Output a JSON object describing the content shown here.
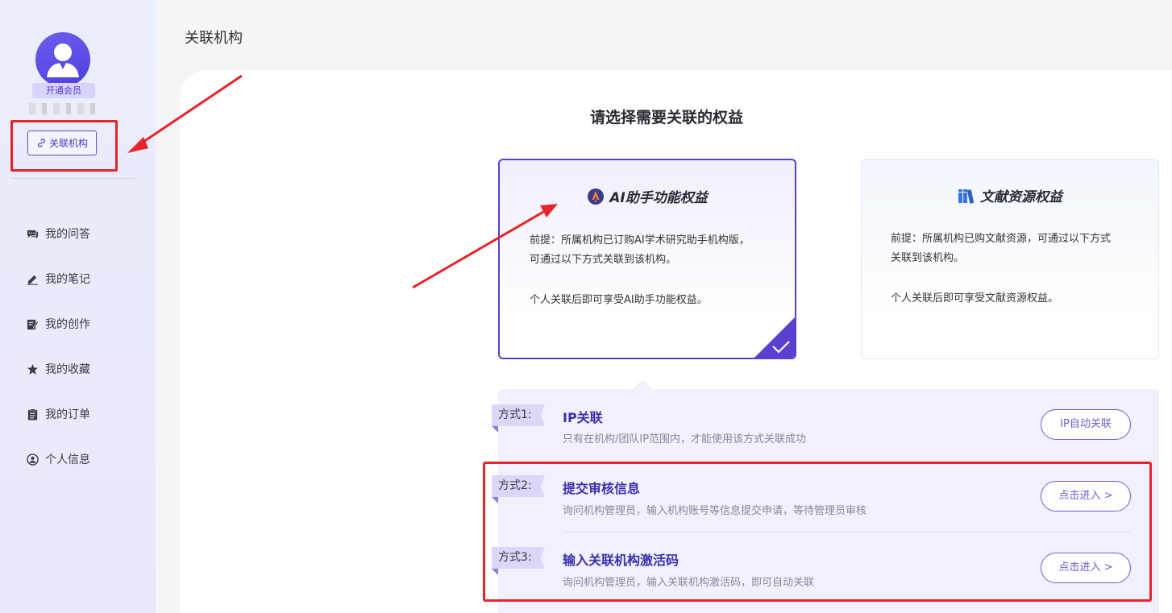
{
  "sidebar": {
    "vip_label": "开通会员",
    "link_org_label": "关联机构",
    "items": [
      {
        "label": "我的问答",
        "icon": "chat-icon"
      },
      {
        "label": "我的笔记",
        "icon": "pen-icon"
      },
      {
        "label": "我的创作",
        "icon": "edit-icon"
      },
      {
        "label": "我的收藏",
        "icon": "star-icon"
      },
      {
        "label": "我的订单",
        "icon": "clipboard-icon"
      },
      {
        "label": "个人信息",
        "icon": "user-circle-icon"
      }
    ]
  },
  "header": {
    "title": "关联机构"
  },
  "main": {
    "heading": "请选择需要关联的权益",
    "cards": {
      "ai": {
        "title": "AI助手功能权益",
        "desc_line1": "前提：所属机构已订购AI学术研究助手机构版，",
        "desc_line2": "可通过以下方式关联到该机构。",
        "note": "个人关联后即可享受AI助手功能权益。",
        "selected": true
      },
      "lib": {
        "title": "文献资源权益",
        "desc_line1": "前提：所属机构已购文献资源，可通过以下方式",
        "desc_line2": "关联到该机构。",
        "note": "个人关联后即可享受文献资源权益。",
        "selected": false
      }
    },
    "methods": [
      {
        "tag": "方式1:",
        "title": "IP关联",
        "desc": "只有在机构/团队IP范围内，才能使用该方式关联成功",
        "button": "IP自动关联"
      },
      {
        "tag": "方式2:",
        "title": "提交审核信息",
        "desc": "询问机构管理员，输入机构账号等信息提交申请，等待管理员审核",
        "button": "点击进入 >"
      },
      {
        "tag": "方式3:",
        "title": "输入关联机构激活码",
        "desc": "询问机构管理员，输入关联机构激活码，即可自动关联",
        "button": "点击进入 >"
      }
    ]
  },
  "colors": {
    "accent": "#5a3fd1",
    "highlight_box": "#e8242a",
    "method_title": "#3a2fae"
  }
}
